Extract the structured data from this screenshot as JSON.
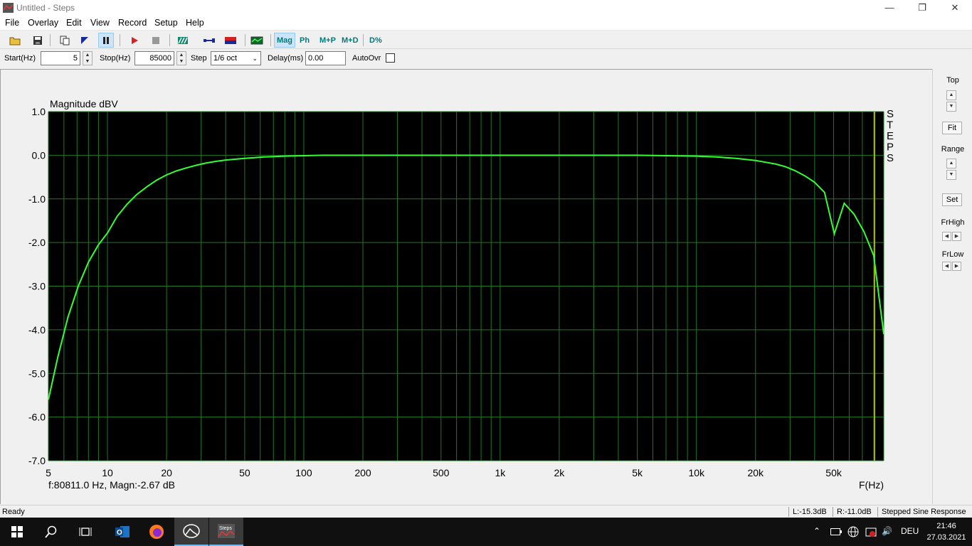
{
  "window": {
    "title": "Untitled - Steps",
    "minimize_icon": "minimize-icon",
    "restore_icon": "restore-icon",
    "close_icon": "close-icon"
  },
  "menu": [
    "File",
    "Overlay",
    "Edit",
    "View",
    "Record",
    "Setup",
    "Help"
  ],
  "toolbar": {
    "mag": "Mag",
    "ph": "Ph",
    "mp": "M+P",
    "md": "M+D",
    "dpct": "D%"
  },
  "controls": {
    "start_label": "Start(Hz)",
    "start_value": "5",
    "stop_label": "Stop(Hz)",
    "stop_value": "85000",
    "step_label": "Step",
    "step_value": "1/6 oct",
    "delay_label": "Delay(ms)",
    "delay_value": "0.00",
    "autoovr_label": "AutoOvr",
    "autoovr_checked": false
  },
  "right_panel": {
    "top": "Top",
    "fit": "Fit",
    "range": "Range",
    "set": "Set",
    "frhigh": "FrHigh",
    "frlow": "FrLow"
  },
  "cursor_readout": "f:80811.0 Hz, Magn:-2.67 dB",
  "status": {
    "ready": "Ready",
    "left": "L:-15.3dB",
    "right": "R:-11.0dB",
    "mode": "Stepped Sine Response"
  },
  "taskbar": {
    "language": "DEU",
    "time": "21:46",
    "date": "27.03.2021"
  },
  "colors": {
    "plot_bg": "#000000",
    "grid": "#1f7a1f",
    "trace": "#33ff33",
    "cursor": "#d4d400"
  },
  "chart_data": {
    "type": "line",
    "title": "Magnitude dBV",
    "xlabel": "F(Hz)",
    "ylabel": "",
    "side_label": "STEPS",
    "x_scale": "log",
    "xlim": [
      5,
      90000
    ],
    "ylim": [
      -7.0,
      1.0
    ],
    "grid": true,
    "y_ticks": [
      "1.0",
      "0.0",
      "-1.0",
      "-2.0",
      "-3.0",
      "-4.0",
      "-5.0",
      "-6.0",
      "-7.0"
    ],
    "x_ticks": [
      {
        "value": 5,
        "label": "5"
      },
      {
        "value": 10,
        "label": "10"
      },
      {
        "value": 20,
        "label": "20"
      },
      {
        "value": 50,
        "label": "50"
      },
      {
        "value": 100,
        "label": "100"
      },
      {
        "value": 200,
        "label": "200"
      },
      {
        "value": 500,
        "label": "500"
      },
      {
        "value": 1000,
        "label": "1k"
      },
      {
        "value": 2000,
        "label": "2k"
      },
      {
        "value": 5000,
        "label": "5k"
      },
      {
        "value": 10000,
        "label": "10k"
      },
      {
        "value": 20000,
        "label": "20k"
      },
      {
        "value": 50000,
        "label": "50k"
      }
    ],
    "cursor_x": 80811,
    "series": [
      {
        "x": [
          5,
          5.6,
          6.3,
          7.1,
          8,
          9,
          10,
          11.2,
          12.6,
          14.1,
          15.9,
          17.8,
          20,
          22.4,
          25.2,
          28.3,
          31.7,
          35.6,
          40,
          50,
          63,
          80,
          100,
          126,
          200,
          500,
          1000,
          2000,
          5000,
          7000,
          10000,
          12600,
          15900,
          20000,
          25200,
          28300,
          31700,
          35600,
          40000,
          44900,
          50400,
          56600,
          63500,
          71300,
          80000,
          90000
        ],
        "y": [
          -5.6,
          -4.6,
          -3.7,
          -3.0,
          -2.45,
          -2.05,
          -1.78,
          -1.4,
          -1.12,
          -0.9,
          -0.72,
          -0.57,
          -0.45,
          -0.36,
          -0.29,
          -0.23,
          -0.18,
          -0.14,
          -0.11,
          -0.07,
          -0.04,
          -0.02,
          -0.01,
          0.0,
          0.0,
          0.0,
          0.0,
          0.0,
          0.0,
          -0.01,
          -0.02,
          -0.04,
          -0.07,
          -0.12,
          -0.2,
          -0.26,
          -0.35,
          -0.47,
          -0.62,
          -0.85,
          -1.8,
          -1.1,
          -1.35,
          -1.75,
          -2.3,
          -4.1
        ]
      }
    ]
  }
}
